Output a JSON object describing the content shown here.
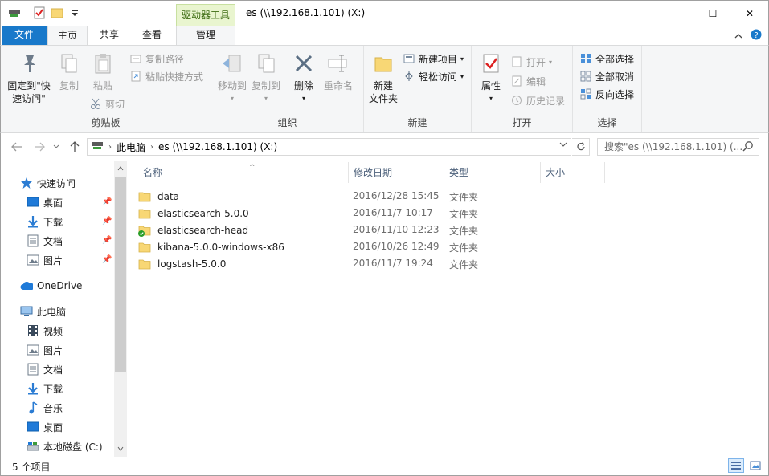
{
  "titlebar": {
    "context_tab_head": "驱动器工具",
    "window_title": "es (\\\\192.168.1.101) (X:)",
    "minimize_glyph": "—",
    "maximize_glyph": "☐",
    "close_glyph": "✕"
  },
  "tabs": {
    "file": "文件",
    "home": "主页",
    "share": "共享",
    "view": "查看",
    "manage": "管理"
  },
  "ribbon": {
    "clipboard": {
      "label": "剪贴板",
      "pin_quick_access_l1": "固定到\"快",
      "pin_quick_access_l2": "速访问\"",
      "copy": "复制",
      "paste": "粘贴",
      "copy_path": "复制路径",
      "paste_shortcut": "粘贴快捷方式",
      "cut": "剪切"
    },
    "organize": {
      "label": "组织",
      "move_to": "移动到",
      "copy_to": "复制到",
      "delete": "删除",
      "rename": "重命名"
    },
    "new": {
      "label": "新建",
      "new_folder_l1": "新建",
      "new_folder_l2": "文件夹",
      "new_item": "新建项目",
      "easy_access": "轻松访问"
    },
    "open": {
      "label": "打开",
      "properties": "属性",
      "open": "打开",
      "edit": "编辑",
      "history": "历史记录"
    },
    "select": {
      "label": "选择",
      "select_all": "全部选择",
      "select_none": "全部取消",
      "invert": "反向选择"
    }
  },
  "address": {
    "crumbs": [
      "此电脑",
      "es (\\\\192.168.1.101) (X:)"
    ],
    "search_placeholder": "搜索\"es (\\\\192.168.1.101) (..."
  },
  "navpane": {
    "quick_access": "快速访问",
    "quick_items": [
      "桌面",
      "下载",
      "文档",
      "图片"
    ],
    "onedrive": "OneDrive",
    "this_pc": "此电脑",
    "pc_items": [
      "视频",
      "图片",
      "文档",
      "下载",
      "音乐",
      "桌面",
      "本地磁盘 (C:)"
    ]
  },
  "columns": {
    "name": "名称",
    "modified": "修改日期",
    "type": "类型",
    "size": "大小"
  },
  "files": [
    {
      "name": "data",
      "modified": "2016/12/28 15:45",
      "type": "文件夹",
      "synced": false
    },
    {
      "name": "elasticsearch-5.0.0",
      "modified": "2016/11/7 10:17",
      "type": "文件夹",
      "synced": false
    },
    {
      "name": "elasticsearch-head",
      "modified": "2016/11/10 12:23",
      "type": "文件夹",
      "synced": true
    },
    {
      "name": "kibana-5.0.0-windows-x86",
      "modified": "2016/10/26 12:49",
      "type": "文件夹",
      "synced": false
    },
    {
      "name": "logstash-5.0.0",
      "modified": "2016/11/7 19:24",
      "type": "文件夹",
      "synced": false
    }
  ],
  "status": {
    "item_count": "5 个项目"
  },
  "colors": {
    "accent": "#1979ca",
    "folder": "#f8d775",
    "context_tab": "#e9f5cf"
  }
}
